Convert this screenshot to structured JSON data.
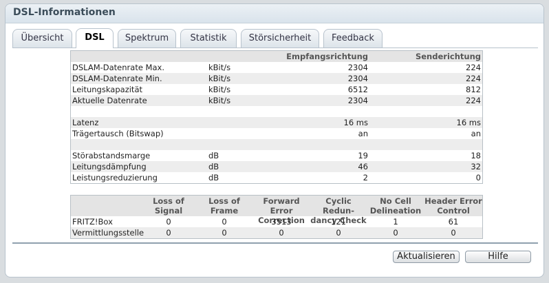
{
  "window": {
    "title": "DSL-Informationen"
  },
  "tabs": [
    {
      "label": "Übersicht"
    },
    {
      "label": "DSL"
    },
    {
      "label": "Spektrum"
    },
    {
      "label": "Statistik"
    },
    {
      "label": "Störsicherheit"
    },
    {
      "label": "Feedback"
    }
  ],
  "active_tab": "DSL",
  "dsl_table": {
    "headers": {
      "receive": "Empfangsrichtung",
      "send": "Senderichtung"
    },
    "rows": [
      {
        "label": "DSLAM-Datenrate Max.",
        "unit": "kBit/s",
        "receive": "2304",
        "send": "224"
      },
      {
        "label": "DSLAM-Datenrate Min.",
        "unit": "kBit/s",
        "receive": "2304",
        "send": "224"
      },
      {
        "label": "Leitungskapazität",
        "unit": "kBit/s",
        "receive": "6512",
        "send": "812"
      },
      {
        "label": "Aktuelle Datenrate",
        "unit": "kBit/s",
        "receive": "2304",
        "send": "224"
      },
      {
        "label": "",
        "unit": "",
        "receive": "",
        "send": ""
      },
      {
        "label": "Latenz",
        "unit": "",
        "receive": "16 ms",
        "send": "16 ms"
      },
      {
        "label": "Trägertausch (Bitswap)",
        "unit": "",
        "receive": "an",
        "send": "an"
      },
      {
        "label": "",
        "unit": "",
        "receive": "",
        "send": ""
      },
      {
        "label": "Störabstandsmarge",
        "unit": "dB",
        "receive": "19",
        "send": "18"
      },
      {
        "label": "Leitungsdämpfung",
        "unit": "dB",
        "receive": "46",
        "send": "32"
      },
      {
        "label": "Leistungsreduzierung",
        "unit": "dB",
        "receive": "2",
        "send": "0"
      }
    ]
  },
  "error_table": {
    "headers": [
      {
        "line1": "Loss of",
        "line2": "Signal"
      },
      {
        "line1": "Loss of",
        "line2": "Frame"
      },
      {
        "line1": "Forward Error",
        "line2": "Correction"
      },
      {
        "line1": "Cyclic Redun-",
        "line2": "dancy Check"
      },
      {
        "line1": "No Cell",
        "line2": "Delineation"
      },
      {
        "line1": "Header Error",
        "line2": "Control"
      }
    ],
    "rows": [
      {
        "label": "FRITZ!Box",
        "values": [
          "0",
          "0",
          "3513",
          "121",
          "1",
          "61"
        ]
      },
      {
        "label": "Vermittlungsstelle",
        "values": [
          "0",
          "0",
          "0",
          "0",
          "0",
          "0"
        ]
      }
    ]
  },
  "buttons": {
    "refresh": "Aktualisieren",
    "help": "Hilfe"
  }
}
